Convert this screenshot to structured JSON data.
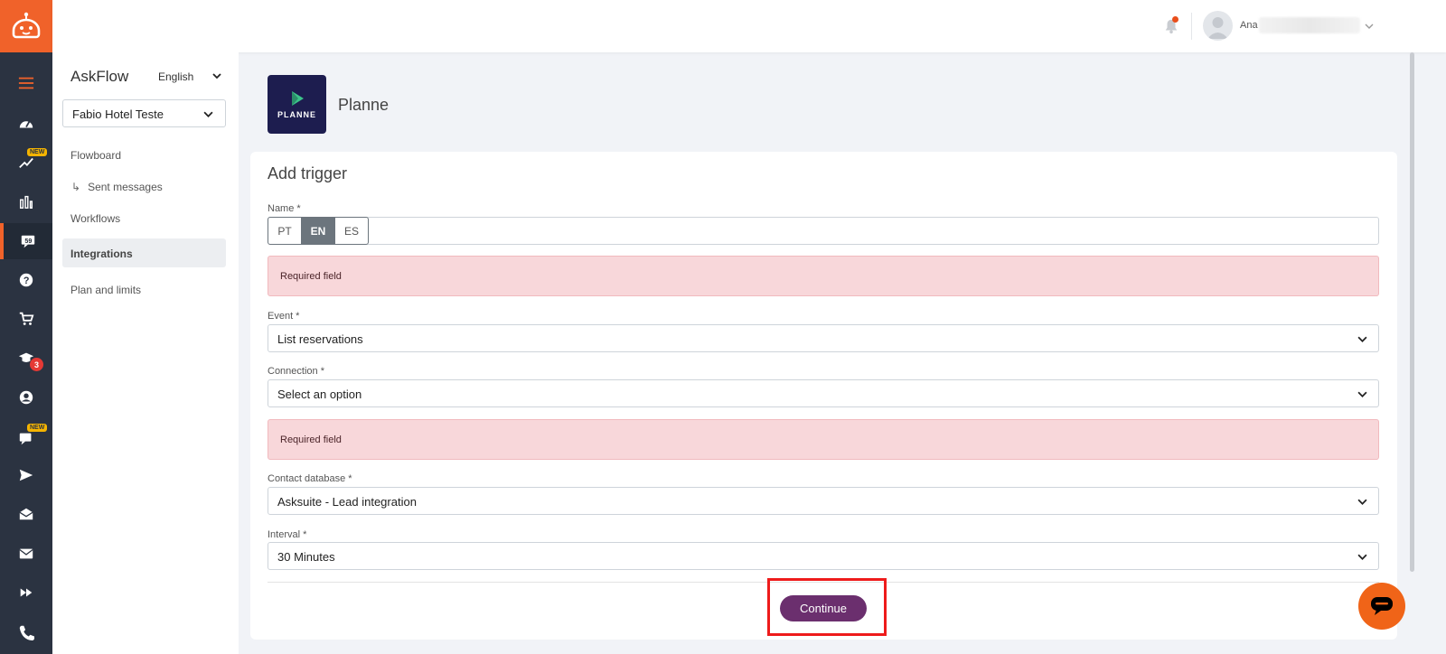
{
  "brand": {
    "accent": "#f0622a",
    "rail_bg": "#2b3341",
    "button": "#6b2f6e"
  },
  "rail": {
    "items": [
      {
        "icon": "hamburger-icon"
      },
      {
        "icon": "dashboard-gauge-icon"
      },
      {
        "icon": "trend-chart-icon",
        "badge": "NEW"
      },
      {
        "icon": "bar-chart-icon"
      },
      {
        "icon": "chat-ticket-icon",
        "active": true
      },
      {
        "icon": "help-icon"
      },
      {
        "icon": "cart-icon"
      },
      {
        "icon": "graduation-cap-icon",
        "count": "3"
      },
      {
        "icon": "user-circle-icon"
      },
      {
        "icon": "chat-bubble-icon",
        "badge": "NEW"
      },
      {
        "icon": "send-icon"
      },
      {
        "icon": "mail-open-icon"
      },
      {
        "icon": "mail-icon"
      },
      {
        "icon": "fast-forward-icon"
      },
      {
        "icon": "phone-icon"
      }
    ]
  },
  "topbar": {
    "username": "Ana"
  },
  "sidebar": {
    "app_name": "AskFlow",
    "language": "English",
    "hotel": "Fabio Hotel Teste",
    "nav": {
      "flowboard": "Flowboard",
      "sent_messages": "Sent messages",
      "workflows": "Workflows",
      "integrations": "Integrations",
      "plan_limits": "Plan and limits"
    }
  },
  "integration": {
    "logo_text": "PLANNE",
    "title": "Planne"
  },
  "form": {
    "title": "Add trigger",
    "name_label": "Name *",
    "lang_tabs": [
      "PT",
      "EN",
      "ES"
    ],
    "required_msg": "Required field",
    "event_label": "Event *",
    "event_value": "List reservations",
    "connection_label": "Connection *",
    "connection_value": "Select an option",
    "contact_label": "Contact database *",
    "contact_value": "Asksuite - Lead integration",
    "interval_label": "Interval *",
    "interval_value": "30 Minutes",
    "continue": "Continue"
  }
}
